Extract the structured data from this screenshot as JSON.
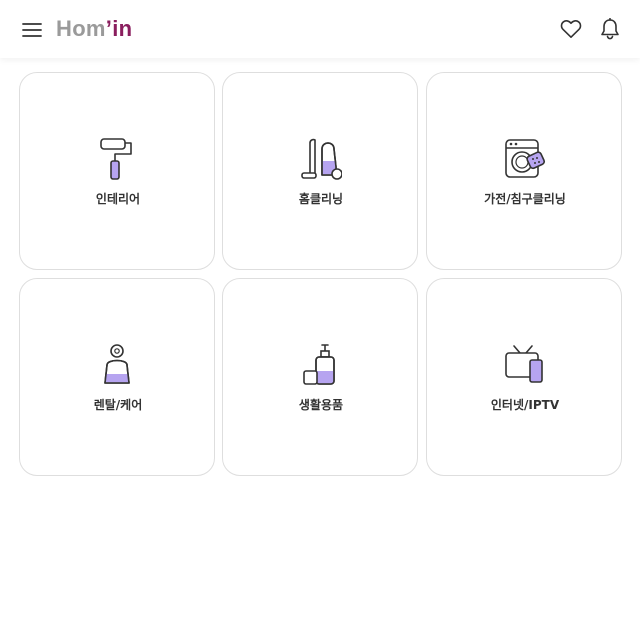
{
  "header": {
    "logo_part1": "Hom",
    "logo_part2": "’in",
    "icons": [
      "hamburger-menu-icon",
      "heart-icon",
      "bell-icon"
    ]
  },
  "colors": {
    "brand": "#8a1e5e",
    "logo_gray": "#9a9a9a",
    "accent_purple": "#b6a4f0",
    "icon_stroke": "#333333",
    "card_border": "#dedede"
  },
  "categories": [
    {
      "label": "인테리어",
      "icon": "paint-roller-icon"
    },
    {
      "label": "홈클리닝",
      "icon": "vacuum-cleaner-icon"
    },
    {
      "label": "가전/침구클리닝",
      "icon": "washing-machine-icon"
    },
    {
      "label": "렌탈/케어",
      "icon": "water-purifier-icon"
    },
    {
      "label": "생활용품",
      "icon": "lotion-bottle-icon"
    },
    {
      "label": "인터넷/IPTV",
      "icon": "tv-phone-icon"
    }
  ]
}
